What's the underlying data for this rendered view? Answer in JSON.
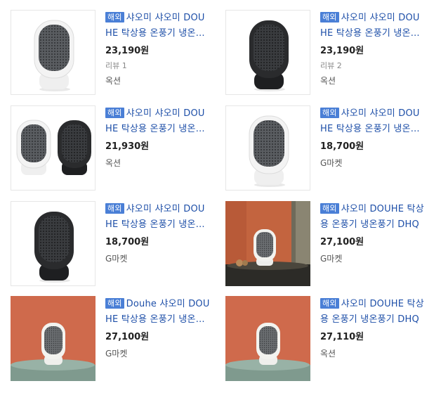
{
  "products": [
    {
      "badge": "해외",
      "title": "샤오미 샤오미 DOUHE 탁상용 온풍기 냉온풍기",
      "price": "23,190원",
      "review": "리뷰 1",
      "seller": "옥션",
      "image": "white-heater-icon"
    },
    {
      "badge": "해외",
      "title": "샤오미 샤오미 DOUHE 탁상용 온풍기 냉온풍기",
      "price": "23,190원",
      "review": "리뷰 2",
      "seller": "옥션",
      "image": "black-heater-icon"
    },
    {
      "badge": "해외",
      "title": "샤오미 샤오미 DOUHE 탁상용 온풍기 냉온풍기",
      "price": "21,930원",
      "review": "",
      "seller": "옥션",
      "image": "white-and-black-heaters-icon"
    },
    {
      "badge": "해외",
      "title": "샤오미 샤오미 DOUHE 탁상용 온풍기 냉온풍기",
      "price": "18,700원",
      "review": "",
      "seller": "G마켓",
      "image": "white-heater-icon"
    },
    {
      "badge": "해외",
      "title": "샤오미 샤오미 DOUHE 탁상용 온풍기 냉온풍기",
      "price": "18,700원",
      "review": "",
      "seller": "G마켓",
      "image": "black-heater-icon"
    },
    {
      "badge": "해외",
      "title": "샤오미 DOUHE 탁상용 온풍기 냉온풍기 DHQ",
      "price": "27,100원",
      "review": "",
      "seller": "G마켓",
      "image": "heater-on-table-photo"
    },
    {
      "badge": "해외",
      "title": "Douhe 샤오미 DOUHE 탁상용 온풍기 냉온풍기",
      "price": "27,100원",
      "review": "",
      "seller": "G마켓",
      "image": "heater-orange-wall-photo"
    },
    {
      "badge": "해외",
      "title": "샤오미 DOUHE 탁상용 온풍기 냉온풍기 DHQ",
      "price": "27,110원",
      "review": "",
      "seller": "옥션",
      "image": "heater-orange-wall-photo"
    }
  ],
  "colors": {
    "title": "#1e4fa8",
    "badge_bg": "#4a7fd6",
    "price": "#222222"
  }
}
